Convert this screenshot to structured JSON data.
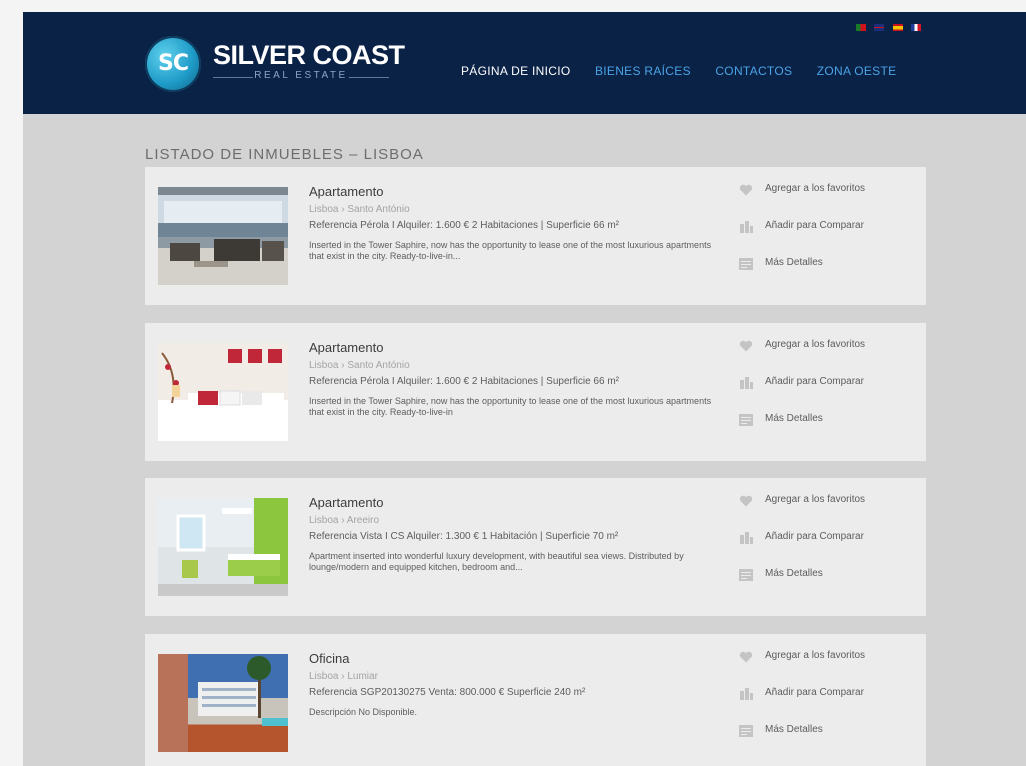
{
  "header": {
    "logo_initials": "SC",
    "brand_name": "SILVER COAST",
    "brand_sub": "REAL ESTATE",
    "languages": [
      "Português",
      "English",
      "Español",
      "Français"
    ],
    "nav": [
      {
        "label": "PÁGINA DE INICIO",
        "active": true
      },
      {
        "label": "BIENES RAÍCES",
        "active": false
      },
      {
        "label": "CONTACTOS",
        "active": false
      },
      {
        "label": "ZONA OESTE",
        "active": false
      }
    ]
  },
  "listing": {
    "title": "LISTADO DE INMUEBLES – LISBOA",
    "actions": {
      "favorite": "Agregar a los favoritos",
      "compare": "Añadir para Comparar",
      "details": "Más Detalles"
    },
    "properties": [
      {
        "type": "Apartamento",
        "location": "Lisboa › Santo António",
        "reference": "Referencia Pérola I    Alquiler: 1.600 €    2 Habitaciones | Superficie 66 m²",
        "description": "Inserted in the Tower Saphire, now has the opportunity to lease one of the most luxurious apartments that exist in the city. Ready-to-live-in..."
      },
      {
        "type": "Apartamento",
        "location": "Lisboa › Santo António",
        "reference": "Referencia Pérola I    Alquiler: 1.600 €    2 Habitaciones | Superficie 66 m²",
        "description": "Inserted in the Tower Saphire, now has the opportunity to lease one of the most luxurious apartments that exist in the city. Ready-to-live-in"
      },
      {
        "type": "Apartamento",
        "location": "Lisboa › Areeiro",
        "reference": "Referencia Vista I CS    Alquiler: 1.300 €    1 Habitación | Superficie 70 m²",
        "description": "Apartment inserted into wonderful luxury development, with beautiful sea views. Distributed by lounge/modern and equipped kitchen, bedroom and..."
      },
      {
        "type": "Oficina",
        "location": "Lisboa › Lumiar",
        "reference": "Referencia SGP20130275    Venta: 800.000 €    Superficie 240 m²",
        "description": "Descripción No Disponible."
      }
    ]
  }
}
